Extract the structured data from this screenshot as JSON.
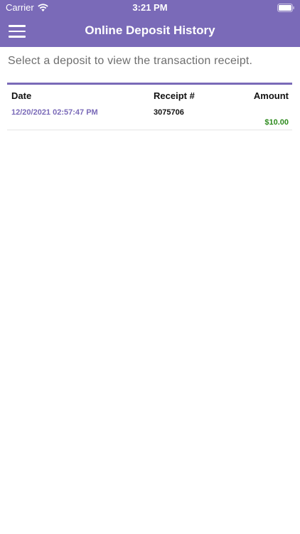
{
  "status_bar": {
    "carrier": "Carrier",
    "time": "3:21 PM"
  },
  "nav": {
    "title": "Online Deposit History",
    "menu_icon": "hamburger-menu-icon"
  },
  "instruction": "Select a deposit to view the transaction receipt.",
  "table": {
    "headers": {
      "date": "Date",
      "receipt": "Receipt #",
      "amount": "Amount"
    },
    "rows": [
      {
        "date": "12/20/2021 02:57:47 PM",
        "receipt": "3075706",
        "amount": "$10.00"
      }
    ]
  },
  "colors": {
    "brand": "#7a6ab8",
    "amount": "#2e8b1e",
    "instruction_text": "#6e6e6e"
  }
}
